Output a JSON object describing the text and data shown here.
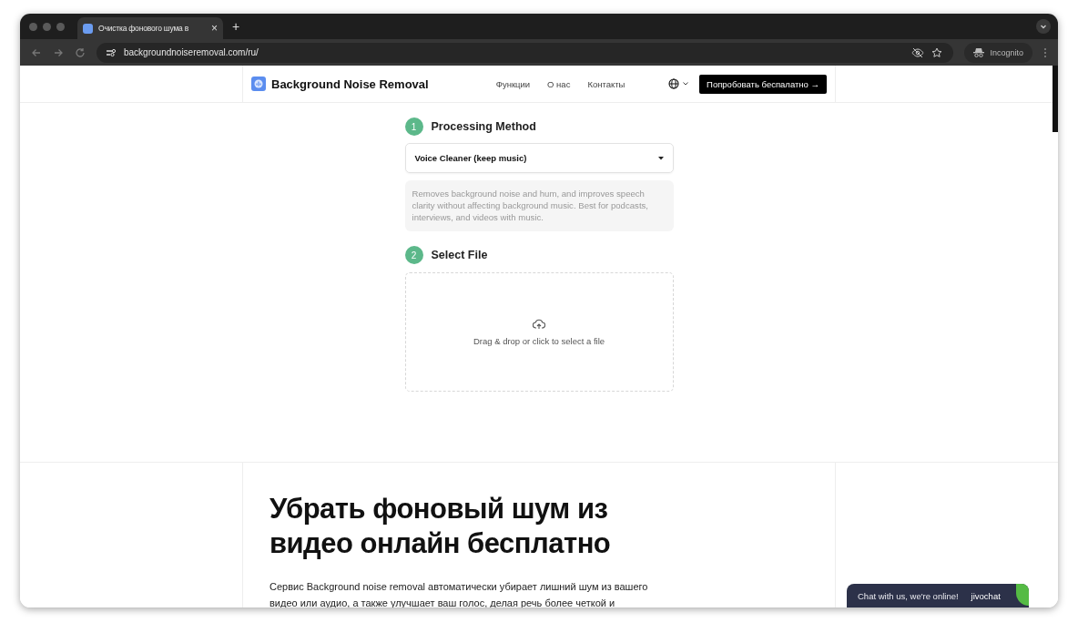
{
  "browser": {
    "tab": {
      "title": "Очистка фонового шума в",
      "close": "×"
    },
    "new_tab": "+",
    "address": "backgroundnoiseremoval.com/ru/",
    "profile": "Incognito"
  },
  "header": {
    "logo": "Background Noise Removal",
    "nav": [
      "Функции",
      "О нас",
      "Контакты"
    ],
    "cta": "Попробовать беспалатно →"
  },
  "steps": [
    {
      "number": "1",
      "title": "Processing Method"
    },
    {
      "number": "2",
      "title": "Select File"
    }
  ],
  "method": {
    "value": "Voice Cleaner (keep music)",
    "description": "Removes background noise and hum, and improves speech clarity without affecting background music. Best for podcasts, interviews, and videos with music."
  },
  "upload": {
    "hint": "Drag & drop or click to select a file"
  },
  "hero": {
    "heading": "Убрать фоновый шум из видео онлайн бесплатно",
    "paragraph": "Сервис Background noise removal автоматически убирает лишний шум из вашего видео или аудио, а также улучшает ваш голос, делая речь более четкой и"
  },
  "chat": {
    "text": "Chat with us, we're online!",
    "brand": "jivochat"
  }
}
